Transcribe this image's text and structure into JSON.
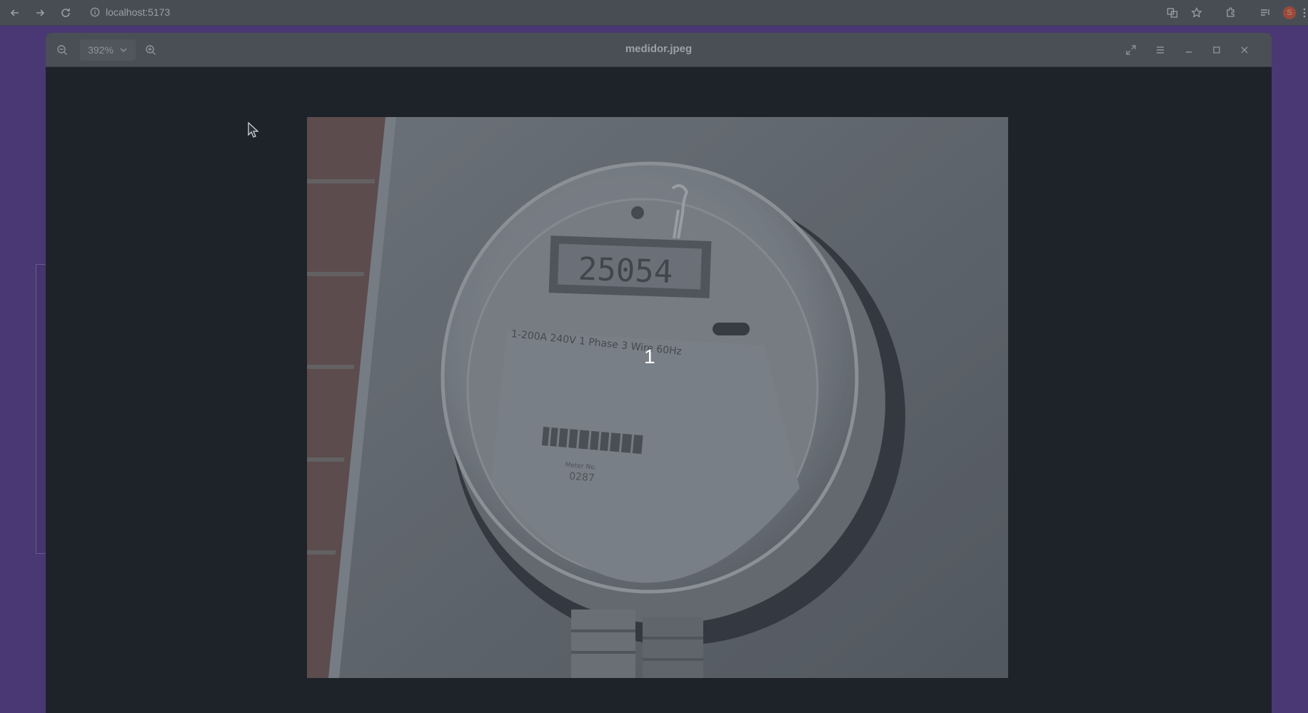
{
  "browser": {
    "url": "localhost:5173",
    "icons": [
      "back-arrow-icon",
      "forward-arrow-icon",
      "reload-icon",
      "info-icon",
      "translate-icon",
      "star-icon",
      "extensions-icon",
      "media-queue-icon",
      "profile-avatar"
    ],
    "avatar_letter": "S"
  },
  "viewer": {
    "title": "medidor.jpeg",
    "zoom": "392%",
    "image_overlay_label": "1"
  },
  "photo": {
    "meter_reading": "25054",
    "rating_text": "1-200A 240V 1 Phase 3 Wire 60Hz",
    "meter_number": "0287",
    "meter_caption": "Meter No."
  }
}
